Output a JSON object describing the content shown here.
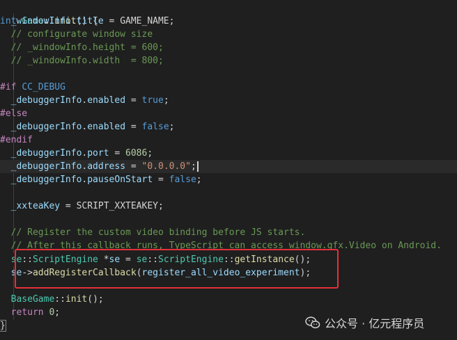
{
  "code": {
    "l1": {
      "kw": "int",
      "cls": "Game",
      "sep": "::",
      "fn": "init",
      "rest": "() {"
    },
    "l2": {
      "indent": "  ",
      "var": "_windowInfo",
      "dot": ".",
      "prop": "title",
      "eq": " = GAME_NAME;"
    },
    "l3": {
      "text": "  // configurate window size"
    },
    "l4": {
      "text": "  // _windowInfo.height = 600;"
    },
    "l5": {
      "text": "  // _windowInfo.width  = 800;"
    },
    "l7": {
      "dir": "#if",
      "macro": "CC_DEBUG"
    },
    "l8": {
      "indent": "  ",
      "var": "_debuggerInfo",
      "dot": ".",
      "prop": "enabled",
      "eq": " = ",
      "val": "true",
      "end": ";"
    },
    "l9": {
      "dir": "#else"
    },
    "l10": {
      "indent": "  ",
      "var": "_debuggerInfo",
      "dot": ".",
      "prop": "enabled",
      "eq": " = ",
      "val": "false",
      "end": ";"
    },
    "l11": {
      "dir": "#endif"
    },
    "l12": {
      "indent": "  ",
      "var": "_debuggerInfo",
      "dot": ".",
      "prop": "port",
      "eq": " = ",
      "val": "6086",
      "end": ";"
    },
    "l13": {
      "indent": "  ",
      "var": "_debuggerInfo",
      "dot": ".",
      "prop": "address",
      "eq": " = ",
      "val": "\"0.0.0.0\"",
      "end": ";"
    },
    "l14": {
      "indent": "  ",
      "var": "_debuggerInfo",
      "dot": ".",
      "prop": "pauseOnStart",
      "eq": " = ",
      "val": "false",
      "end": ";"
    },
    "l16": {
      "indent": "  ",
      "var": "_xxteaKey",
      "eq": " = SCRIPT_XXTEAKEY;"
    },
    "l18": {
      "text": "  // Register the custom video binding before JS starts."
    },
    "l19": {
      "text": "  // After this callback runs, TypeScript can access window.gfx.Video on Android."
    },
    "l20": {
      "indent": "  ",
      "ns": "se",
      "sep": "::",
      "cls": "ScriptEngine",
      "mid": " *",
      "var": "se",
      "eq": " = ",
      "ns2": "se",
      "sep2": "::",
      "cls2": "ScriptEngine",
      "sep3": "::",
      "fn": "getInstance",
      "end": "();"
    },
    "l21": {
      "indent": "  ",
      "var": "se",
      "arrow": "->",
      "fn": "addRegisterCallback",
      "open": "(",
      "arg": "register_all_video_experiment",
      "end": ");"
    },
    "l23": {
      "indent": "  ",
      "cls": "BaseGame",
      "sep": "::",
      "fn": "init",
      "end": "();"
    },
    "l24": {
      "indent": "  ",
      "kw": "return",
      "sp": " ",
      "num": "0",
      "end": ";"
    },
    "l25": {
      "text": "}"
    }
  },
  "watermark": {
    "text": "公众号 · 亿元程序员"
  },
  "colors": {
    "background": "#1f1f1f",
    "highlight_box": "#e5313a"
  }
}
